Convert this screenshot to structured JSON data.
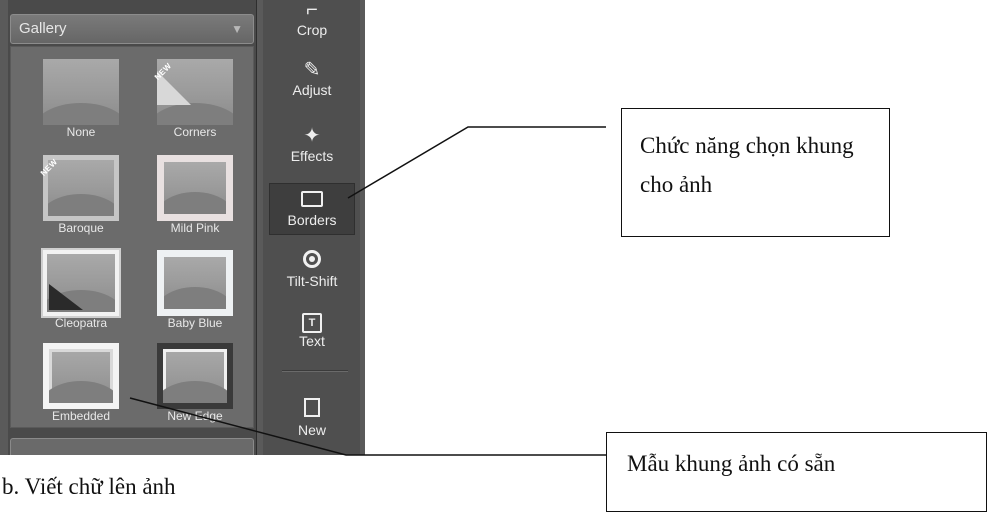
{
  "gallery": {
    "title": "Gallery",
    "items": [
      {
        "label": "None",
        "new": false
      },
      {
        "label": "Corners",
        "new": true
      },
      {
        "label": "Baroque",
        "new": true
      },
      {
        "label": "Mild Pink",
        "new": false
      },
      {
        "label": "Cleopatra",
        "new": false
      },
      {
        "label": "Baby Blue",
        "new": false
      },
      {
        "label": "Embedded",
        "new": false
      },
      {
        "label": "New Edge",
        "new": false
      }
    ],
    "badge": "NEW"
  },
  "tools": {
    "crop": "Crop",
    "adjust": "Adjust",
    "effects": "Effects",
    "borders": "Borders",
    "tilt_shift": "Tilt-Shift",
    "text": "Text",
    "new": "New",
    "text_icon_letter": "T"
  },
  "annotations": {
    "borders_note": "Chức năng chọn khung cho ảnh",
    "gallery_note": "Mẫu khung ảnh có sẵn"
  },
  "caption": "b. Viết chữ lên ảnh"
}
